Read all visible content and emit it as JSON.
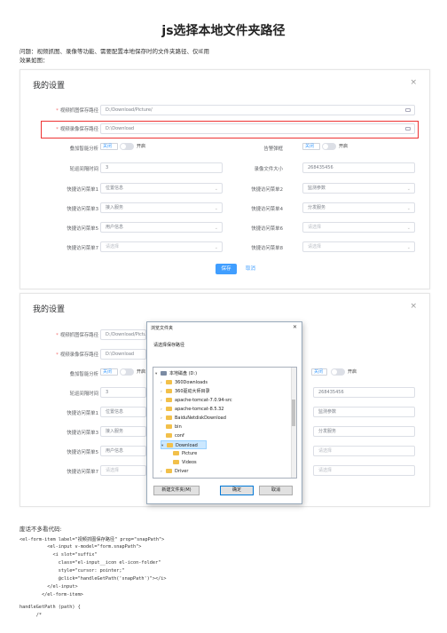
{
  "article": {
    "title": "js选择本地文件夹路径",
    "intro_line1": "问题：视频抓图、录像等功能、需要配置本地保存时的文件夹路径、仅IE用",
    "intro_line2": "效果如图：",
    "note": "废话不多看代码:",
    "code_lines": [
      "<el-form-item label=\"视频抓图保存路径\" prop=\"snapPath\">",
      "          <el-input v-model=\"form.snapPath\">",
      "            <i slot=\"suffix\"",
      "              class=\"el-input__icon el-icon-folder\"",
      "              style=\"cursor: pointer;\"",
      "              @click=\"handleGetPath('snapPath')\"></i>",
      "          </el-input>",
      "        </el-form-item>",
      "handleGetPath (path) {",
      "      /*"
    ]
  },
  "dialog": {
    "title": "我的设置",
    "close": "×",
    "snap_label": "视频抓图保存路径",
    "snap_value": "D:/Download/Picture/",
    "snap_value_short": "D:/Download/Picture",
    "record_label": "视频录像保存路径",
    "record_value": "D:\\Download",
    "smart_label": "叠加智能分析",
    "alarm_label": "告警弹框",
    "off": "关闭",
    "on": "开启",
    "interval_label": "轮巡间隔时间",
    "interval_value": "3",
    "filesize_label": "录像文件大小",
    "filesize_value": "268435456",
    "menu1_label": "快捷访问菜单1",
    "menu1_value": "位置信息",
    "menu2_label": "快捷访问菜单2",
    "menu2_value": "监测参数",
    "menu3_label": "快捷访问菜单3",
    "menu3_value": "接入服务",
    "menu4_label": "快捷访问菜单4",
    "menu4_value": "分发服务",
    "menu5_label": "快捷访问菜单5",
    "menu5_value": "用户信息",
    "menu6_label": "快捷访问菜单6",
    "menu6_value": "请选择",
    "menu7_label": "快捷访问菜单7",
    "menu7_value": "请选择",
    "menu8_label": "快捷访问菜单8",
    "menu8_value": "请选择",
    "save": "保存",
    "cancel": "取消"
  },
  "browse": {
    "title": "浏览文件夹",
    "close": "✕",
    "prompt": "请选择保存路径",
    "items": [
      {
        "name": "本地磁盘 (D:)",
        "icon": "drive-icon",
        "caret": "▾"
      },
      {
        "name": "360Downloads",
        "icon": "folder-icon",
        "caret": "›"
      },
      {
        "name": "360驱动大师目录",
        "icon": "folder-icon",
        "caret": "›"
      },
      {
        "name": "apache-tomcat-7.0.94-src",
        "icon": "folder-icon",
        "caret": "›"
      },
      {
        "name": "apache-tomcat-8.5.32",
        "icon": "folder-icon",
        "caret": "›"
      },
      {
        "name": "BaiduNetdiskDownload",
        "icon": "folder-icon",
        "caret": "›"
      },
      {
        "name": "bin",
        "icon": "folder-icon",
        "caret": ""
      },
      {
        "name": "conf",
        "icon": "folder-icon",
        "caret": ""
      },
      {
        "name": "Download",
        "icon": "folder-icon",
        "caret": "▾"
      },
      {
        "name": "Picture",
        "icon": "folder-icon",
        "caret": ""
      },
      {
        "name": "Videos",
        "icon": "folder-icon",
        "caret": ""
      },
      {
        "name": "Driver",
        "icon": "folder-icon",
        "caret": "›"
      },
      {
        "name": "eclipse1",
        "icon": "folder-icon",
        "caret": "›"
      }
    ],
    "new_folder": "新建文件夹(M)",
    "ok": "确定",
    "cancel": "取消"
  }
}
